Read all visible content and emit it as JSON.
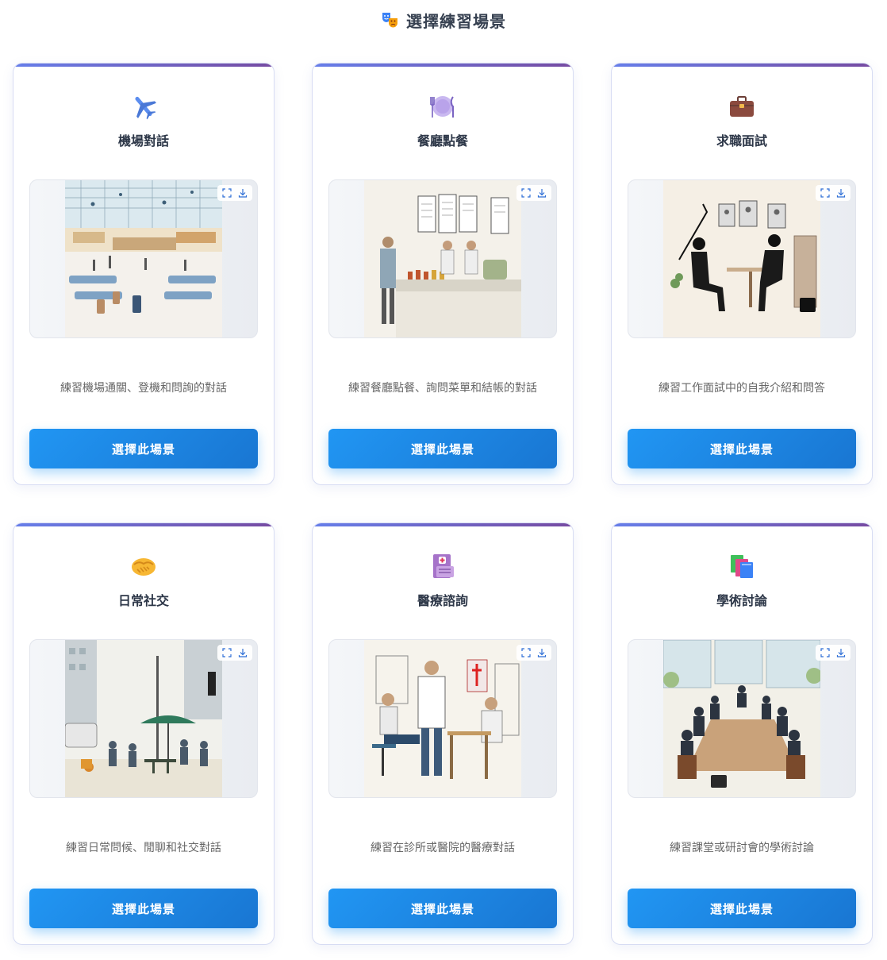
{
  "header": {
    "icon": "theater-masks-icon",
    "title": "選擇練習場景"
  },
  "button_label": "選擇此場景",
  "image_tools": {
    "fullscreen_icon": "fullscreen-icon",
    "download_icon": "download-icon"
  },
  "scenarios": [
    {
      "id": "airport",
      "icon": "airplane-icon",
      "title": "機場對話",
      "description": "練習機場通關、登機和問詢的對話"
    },
    {
      "id": "restaurant",
      "icon": "fork-knife-plate-icon",
      "title": "餐廳點餐",
      "description": "練習餐廳點餐、詢問菜單和結帳的對話"
    },
    {
      "id": "interview",
      "icon": "briefcase-icon",
      "title": "求職面試",
      "description": "練習工作面試中的自我介紹和問答"
    },
    {
      "id": "social",
      "icon": "handshake-icon",
      "title": "日常社交",
      "description": "練習日常問候、閒聊和社交對話"
    },
    {
      "id": "medical",
      "icon": "medical-record-icon",
      "title": "醫療諮詢",
      "description": "練習在診所或醫院的醫療對話"
    },
    {
      "id": "academic",
      "icon": "books-icon",
      "title": "學術討論",
      "description": "練習課堂或研討會的學術討論"
    }
  ],
  "colors": {
    "accent_start": "#667eea",
    "accent_end": "#764ba2",
    "button_start": "#2196f3",
    "button_end": "#1976d2"
  }
}
